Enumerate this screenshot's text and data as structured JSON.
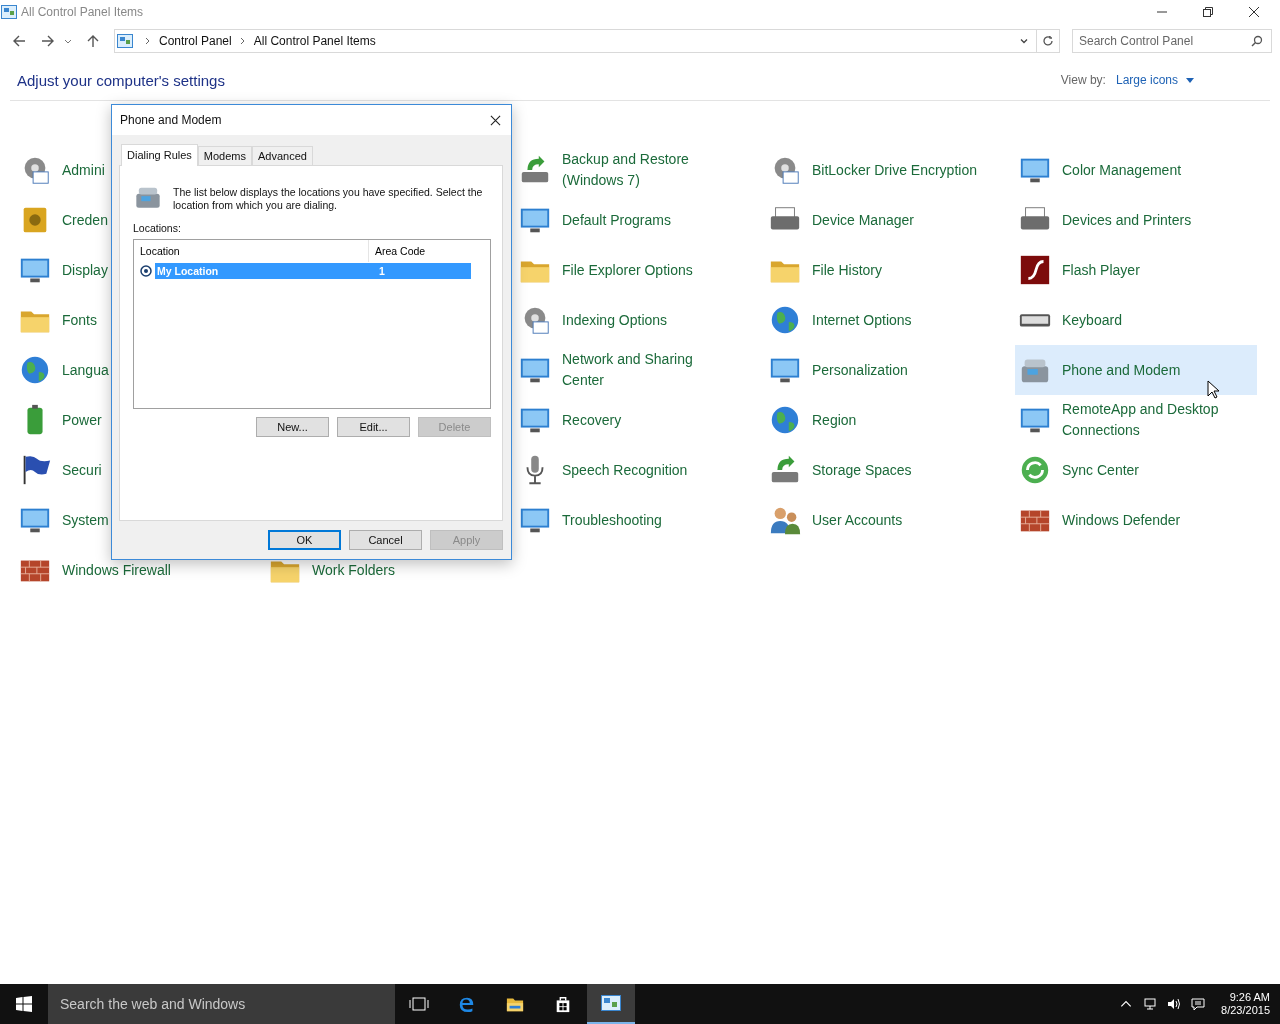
{
  "window": {
    "title": "All Control Panel Items"
  },
  "address": {
    "breadcrumb": [
      "Control Panel",
      "All Control Panel Items"
    ],
    "search_placeholder": "Search Control Panel"
  },
  "header": {
    "heading": "Adjust your computer's settings",
    "view_by_label": "View by:",
    "view_by_value": "Large icons"
  },
  "columns": [
    {
      "items": [
        {
          "label": "Admini",
          "hovered": false
        },
        {
          "label": "Creden",
          "hovered": false
        },
        {
          "label": "Display",
          "hovered": false
        },
        {
          "label": "Fonts",
          "hovered": false
        },
        {
          "label": "Langua",
          "hovered": false
        },
        {
          "label": "Power",
          "hovered": false
        },
        {
          "label": "Securi",
          "hovered": false
        },
        {
          "label": "System",
          "hovered": false
        },
        {
          "label": "Windows Firewall",
          "hovered": false
        }
      ]
    },
    {
      "items": [
        {
          "label": "Work Folders",
          "hovered": false
        }
      ]
    },
    {
      "items": [
        {
          "label": "Backup and Restore (Windows 7)",
          "hovered": false
        },
        {
          "label": "Default Programs",
          "hovered": false
        },
        {
          "label": "File Explorer Options",
          "hovered": false
        },
        {
          "label": "Indexing Options",
          "hovered": false
        },
        {
          "label": "Network and Sharing Center",
          "hovered": false
        },
        {
          "label": "Recovery",
          "hovered": false
        },
        {
          "label": "Speech Recognition",
          "hovered": false
        },
        {
          "label": "Troubleshooting",
          "hovered": false
        }
      ]
    },
    {
      "items": [
        {
          "label": "BitLocker Drive Encryption",
          "hovered": false
        },
        {
          "label": "Device Manager",
          "hovered": false
        },
        {
          "label": "File History",
          "hovered": false
        },
        {
          "label": "Internet Options",
          "hovered": false
        },
        {
          "label": "Personalization",
          "hovered": false
        },
        {
          "label": "Region",
          "hovered": false
        },
        {
          "label": "Storage Spaces",
          "hovered": false
        },
        {
          "label": "User Accounts",
          "hovered": false
        }
      ]
    },
    {
      "items": [
        {
          "label": "Color Management",
          "hovered": false
        },
        {
          "label": "Devices and Printers",
          "hovered": false
        },
        {
          "label": "Flash Player",
          "hovered": false
        },
        {
          "label": "Keyboard",
          "hovered": false
        },
        {
          "label": "Phone and Modem",
          "hovered": true
        },
        {
          "label": "RemoteApp and Desktop Connections",
          "hovered": false
        },
        {
          "label": "Sync Center",
          "hovered": false
        },
        {
          "label": "Windows Defender",
          "hovered": false
        }
      ]
    }
  ],
  "dialog": {
    "title": "Phone and Modem",
    "tabs": [
      {
        "label": "Dialing Rules",
        "selected": true
      },
      {
        "label": "Modems",
        "selected": false
      },
      {
        "label": "Advanced",
        "selected": false
      }
    ],
    "description": "The list below displays the locations you have specified. Select the location from which you are dialing.",
    "list_label": "Locations:",
    "list_columns": [
      "Location",
      "Area Code"
    ],
    "rows": [
      {
        "location": "My Location",
        "area_code": "1",
        "selected": true,
        "current": true
      }
    ],
    "list_buttons": [
      {
        "label": "New...",
        "disabled": false
      },
      {
        "label": "Edit...",
        "disabled": false
      },
      {
        "label": "Delete",
        "disabled": true
      }
    ],
    "buttons": [
      {
        "label": "OK",
        "disabled": false,
        "default": true
      },
      {
        "label": "Cancel",
        "disabled": false,
        "default": false
      },
      {
        "label": "Apply",
        "disabled": true,
        "default": false
      }
    ]
  },
  "taskbar": {
    "search_placeholder": "Search the web and Windows",
    "time": "9:26 AM",
    "date": "8/23/2015"
  }
}
